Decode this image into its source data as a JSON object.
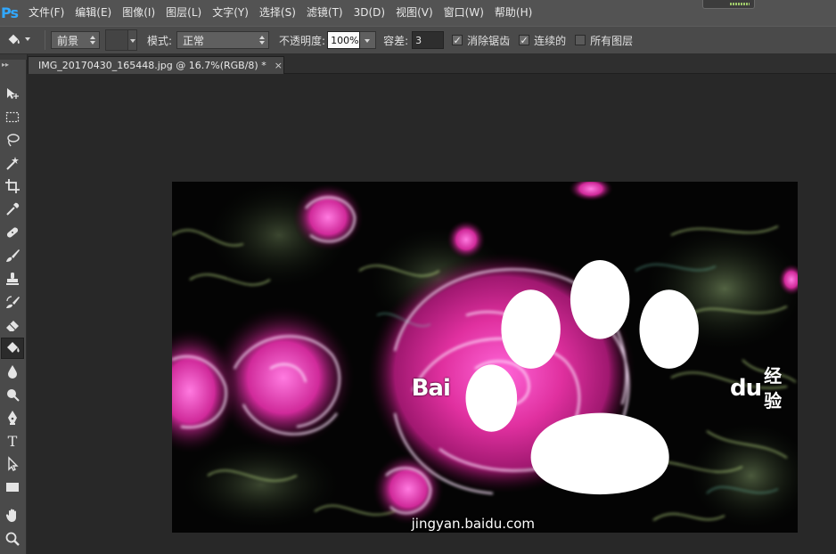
{
  "app": {
    "logo": "Ps",
    "accent": "#31a8ff"
  },
  "menu": {
    "items": [
      {
        "label": "文件(F)"
      },
      {
        "label": "编辑(E)"
      },
      {
        "label": "图像(I)"
      },
      {
        "label": "图层(L)"
      },
      {
        "label": "文字(Y)"
      },
      {
        "label": "选择(S)"
      },
      {
        "label": "滤镜(T)"
      },
      {
        "label": "3D(D)"
      },
      {
        "label": "视图(V)"
      },
      {
        "label": "窗口(W)"
      },
      {
        "label": "帮助(H)"
      }
    ]
  },
  "options": {
    "tool_icon": "paint-bucket-icon",
    "fill_source": "前景",
    "mode_label": "模式:",
    "mode_value": "正常",
    "opacity_label": "不透明度:",
    "opacity_value": "100%",
    "tolerance_label": "容差:",
    "tolerance_value": "3",
    "antialias_label": "消除锯齿",
    "antialias_checked": true,
    "contiguous_label": "连续的",
    "contiguous_checked": true,
    "all_layers_label": "所有图层",
    "all_layers_checked": false
  },
  "tools": [
    {
      "name": "move-tool",
      "icon": "move-icon"
    },
    {
      "name": "marquee-tool",
      "icon": "rect-marquee-icon"
    },
    {
      "name": "lasso-tool",
      "icon": "lasso-icon"
    },
    {
      "name": "magic-wand-tool",
      "icon": "magic-wand-icon"
    },
    {
      "name": "crop-tool",
      "icon": "crop-icon"
    },
    {
      "name": "eyedropper-tool",
      "icon": "eyedropper-icon"
    },
    {
      "name": "healing-brush-tool",
      "icon": "bandage-icon"
    },
    {
      "name": "brush-tool",
      "icon": "brush-icon"
    },
    {
      "name": "clone-stamp-tool",
      "icon": "stamp-icon"
    },
    {
      "name": "history-brush-tool",
      "icon": "history-brush-icon"
    },
    {
      "name": "eraser-tool",
      "icon": "eraser-icon"
    },
    {
      "name": "paint-bucket-tool",
      "icon": "paint-bucket-icon",
      "active": true
    },
    {
      "name": "blur-tool",
      "icon": "drop-icon"
    },
    {
      "name": "dodge-tool",
      "icon": "dodge-icon"
    },
    {
      "name": "pen-tool",
      "icon": "pen-icon"
    },
    {
      "name": "type-tool",
      "icon": "type-icon",
      "glyph": "T"
    },
    {
      "name": "path-selection-tool",
      "icon": "arrow-icon"
    },
    {
      "name": "shape-tool",
      "icon": "rectangle-icon"
    },
    {
      "name": "hand-tool",
      "icon": "hand-icon"
    },
    {
      "name": "zoom-tool",
      "icon": "zoom-icon"
    }
  ],
  "document": {
    "tab_title": "IMG_20170430_165448.jpg @ 16.7%(RGB/8) *",
    "close_glyph": "×"
  },
  "watermark": {
    "logo_text_a": "Bai",
    "logo_text_b": "du",
    "logo_cn": "经验",
    "url": "jingyan.baidu.com"
  }
}
